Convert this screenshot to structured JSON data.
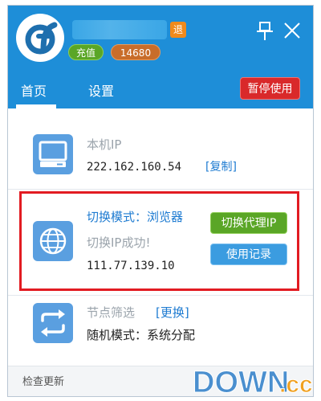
{
  "header": {
    "tui_badge": "退",
    "recharge_label": "充值",
    "balance": "14680"
  },
  "tabs": [
    {
      "label": "首页"
    },
    {
      "label": "设置"
    }
  ],
  "pause_label": "暂停使用",
  "local_ip": {
    "label": "本机IP",
    "value": "222.162.160.54",
    "copy_link": "[复制]"
  },
  "switch": {
    "mode_label": "切换模式：浏览器",
    "status": "切换IP成功!",
    "ip": "111.77.139.10",
    "switch_button": "切换代理IP",
    "history_button": "使用记录"
  },
  "node": {
    "label": "节点筛选",
    "change_link": "[更换]",
    "mode": "随机模式：系统分配"
  },
  "footer": {
    "check_update": "检查更新"
  },
  "watermark": {
    "text_main": "DOWN",
    "text_suffix": ".cc"
  },
  "colors": {
    "header_bg": "#1e8ed8",
    "pause_bg": "#d9292a",
    "green": "#5aa626",
    "blue": "#3b9ce0",
    "highlight": "#e21b22"
  }
}
